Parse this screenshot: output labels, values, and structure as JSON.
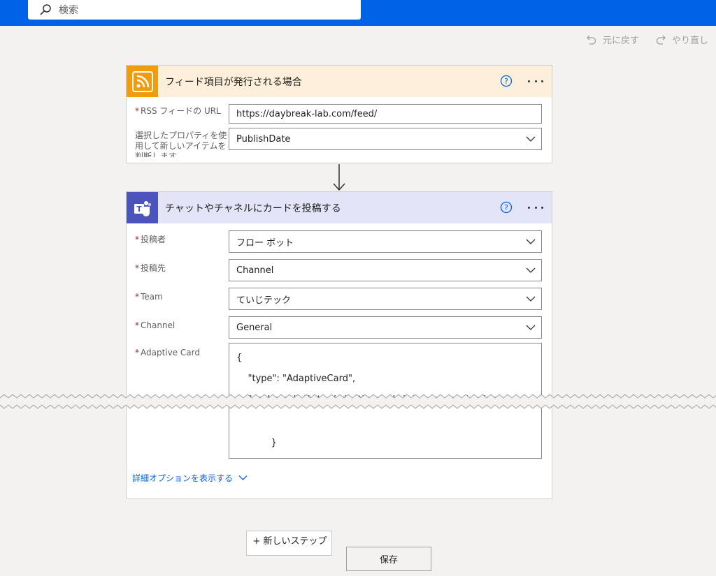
{
  "search": {
    "placeholder": "検索"
  },
  "commands": {
    "undo": "元に戻す",
    "redo": "やり直し"
  },
  "rss_card": {
    "title": "フィード項目が発行される場合",
    "accent": "#fdefd9",
    "icon_bg": "#f09c0e",
    "fields": [
      {
        "label": "RSS フィードの URL",
        "required": true,
        "value": "https://daybreak-lab.com/feed/"
      },
      {
        "label": "選択したプロパティを使用して新しいアイテムを判断します",
        "required": false,
        "value": "PublishDate"
      }
    ]
  },
  "teams_card": {
    "title": "チャットやチャネルにカードを投稿する",
    "accent": "#e3e4f7",
    "icon_bg": "#4b53bc",
    "fields": [
      {
        "label": "投稿者",
        "required": true,
        "value": "フロー ボット"
      },
      {
        "label": "投稿先",
        "required": true,
        "value": "Channel"
      },
      {
        "label": "Team",
        "required": true,
        "value": "ていじテック"
      },
      {
        "label": "Channel",
        "required": true,
        "value": "General"
      },
      {
        "label": "Adaptive Card",
        "required": true
      }
    ],
    "card_code": {
      "line1": "{",
      "line2": "    \"type\": \"AdaptiveCard\",",
      "line3": "    \"$schema\": \"http://adaptivecards.io/schemas/adaptive-",
      "line4": "            }",
      "line5": "        ]",
      "line6": "}"
    },
    "advanced_link": "詳細オプションを表示する"
  },
  "buttons": {
    "new_step": "+ 新しいステップ",
    "save": "保存"
  }
}
